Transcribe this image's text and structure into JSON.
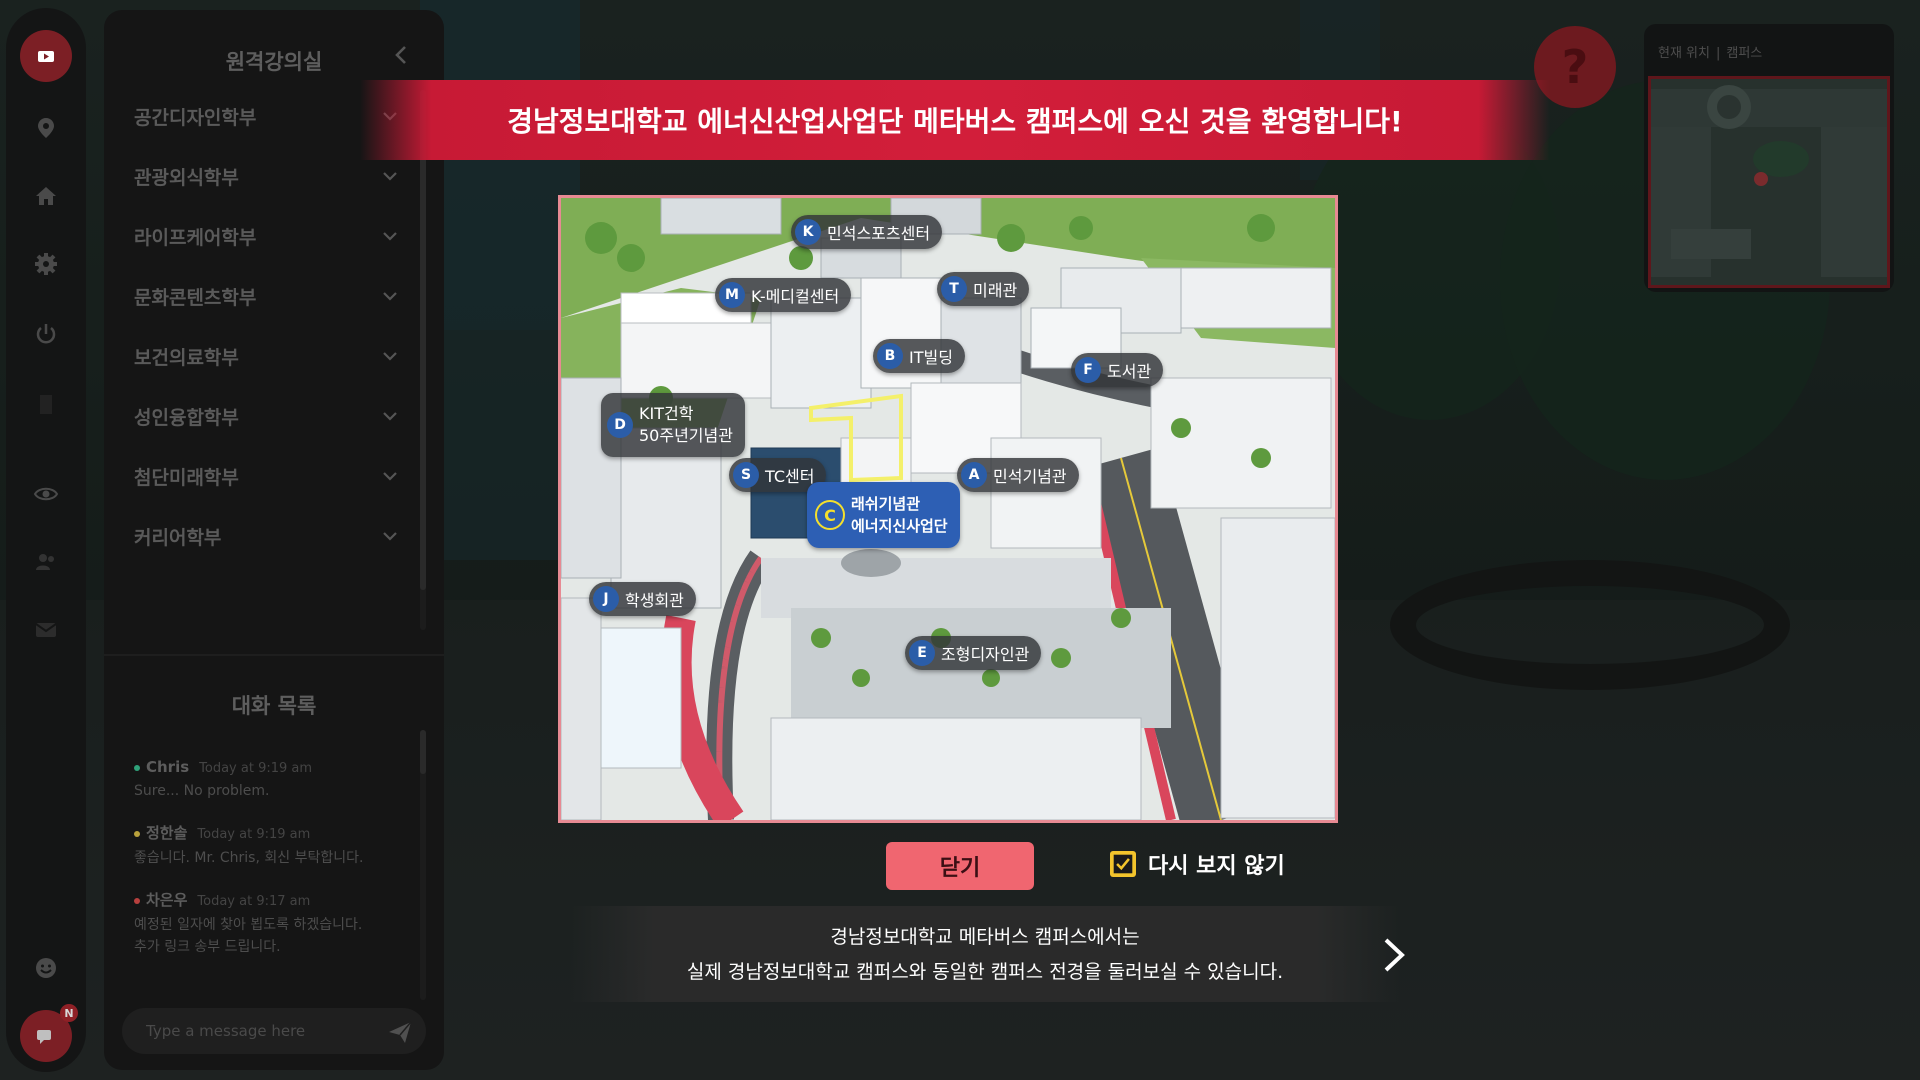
{
  "rail": {
    "items": [
      {
        "icon": "video-icon",
        "active": true
      },
      {
        "icon": "location-pin-icon"
      },
      {
        "icon": "home-icon"
      },
      {
        "icon": "gear-icon"
      },
      {
        "icon": "power-icon"
      },
      {
        "icon": "eye-icon"
      },
      {
        "icon": "users-icon"
      },
      {
        "icon": "mail-icon"
      },
      {
        "icon": "smile-icon"
      },
      {
        "icon": "chat-icon",
        "badge": "N"
      }
    ]
  },
  "panel": {
    "title": "원격강의실",
    "departments": [
      "공간디자인학부",
      "관광외식학부",
      "라이프케어학부",
      "문화콘텐츠학부",
      "보건의료학부",
      "성인융합학부",
      "첨단미래학부",
      "커리어학부"
    ]
  },
  "chat": {
    "title": "대화 목록",
    "messages": [
      {
        "name": "Chris",
        "time": "Today at 9:19 am",
        "text": [
          "Sure... No problem."
        ],
        "color": "#2fa27a"
      },
      {
        "name": "정한솔",
        "time": "Today at 9:19 am",
        "text": [
          "좋습니다. Mr. Chris, 회신 부탁합니다."
        ],
        "color": "#b9a23c"
      },
      {
        "name": "차은우",
        "time": "Today at 9:17 am",
        "text": [
          "예정된 일자에 찾아 뵙도록 하겠습니다.",
          "추가 링크 송부 드립니다."
        ],
        "color": "#b8403e"
      }
    ],
    "input_placeholder": "Type a message here"
  },
  "minimap": {
    "label_left": "현재 위치",
    "separator": "|",
    "label_right": "캠퍼스"
  },
  "help": {
    "label": "?"
  },
  "modal": {
    "banner": "경남정보대학교 에너신산업사업단 메타버스 캠퍼스에 오신 것을 환영합니다!",
    "pois": [
      {
        "code": "K",
        "name": "민석스포츠센터"
      },
      {
        "code": "M",
        "name": "K-메디컬센터"
      },
      {
        "code": "T",
        "name": "미래관"
      },
      {
        "code": "B",
        "name": "IT빌딩"
      },
      {
        "code": "F",
        "name": "도서관"
      },
      {
        "code": "D",
        "name": "KIT건학",
        "name2": "50주년기념관"
      },
      {
        "code": "S",
        "name": "TC센터"
      },
      {
        "code": "A",
        "name": "민석기념관"
      },
      {
        "code": "C",
        "name": "래쉬기념관",
        "name2": "에너지신사업단"
      },
      {
        "code": "J",
        "name": "학생회관"
      },
      {
        "code": "E",
        "name": "조형디자인관"
      }
    ],
    "close_label": "닫기",
    "dont_show_label": "다시 보지 않기",
    "dont_show_checked": true,
    "desc_line1": "경남정보대학교 메타버스 캠퍼스에서는",
    "desc_line2": "실제 경남정보대학교 캠퍼스와 동일한 캠퍼스 전경을 둘러보실 수 있습니다."
  },
  "colors": {
    "accent": "#d21e3a",
    "poi_badge": "#2b5da8",
    "close_button": "#f06670",
    "checkbox": "#f3c42c"
  }
}
